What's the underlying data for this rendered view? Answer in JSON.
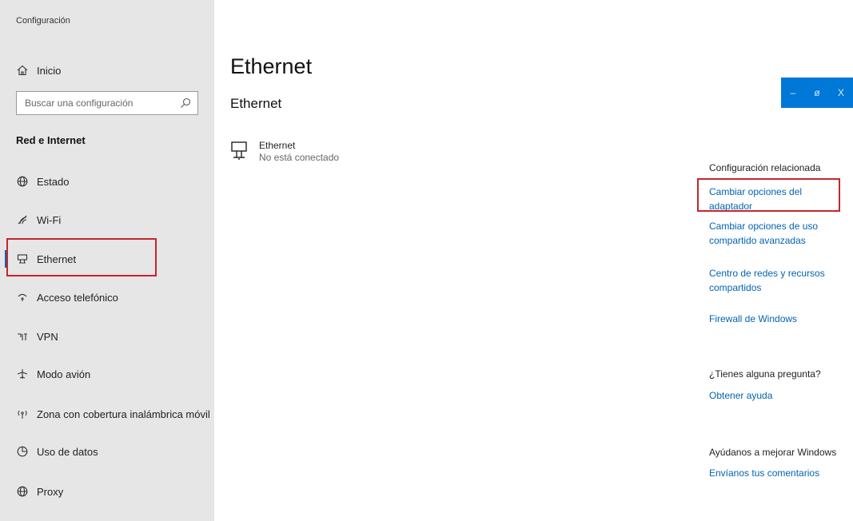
{
  "window": {
    "app_title": "Configuración"
  },
  "sidebar": {
    "home_label": "Inicio",
    "search_placeholder": "Buscar una configuración",
    "section_title": "Red e Internet",
    "items": [
      {
        "label": "Estado",
        "icon": "globe-status-icon"
      },
      {
        "label": "Wi-Fi",
        "icon": "wifi-icon"
      },
      {
        "label": "Ethernet",
        "icon": "ethernet-icon",
        "selected": true
      },
      {
        "label": "Acceso telefónico",
        "icon": "dialup-icon"
      },
      {
        "label": "VPN",
        "icon": "vpn-icon"
      },
      {
        "label": "Modo avión",
        "icon": "airplane-icon"
      },
      {
        "label": "Zona con cobertura inalámbrica móvil",
        "icon": "hotspot-icon"
      },
      {
        "label": "Uso de datos",
        "icon": "data-usage-icon"
      },
      {
        "label": "Proxy",
        "icon": "proxy-icon"
      }
    ]
  },
  "main": {
    "page_title": "Ethernet",
    "sub_title": "Ethernet",
    "network": {
      "name": "Ethernet",
      "status": "No está conectado"
    }
  },
  "window_controls": {
    "minimize": "–",
    "restore": "ø",
    "close": "X"
  },
  "related": {
    "heading": "Configuración relacionada",
    "links": [
      "Cambiar opciones del adaptador",
      "Cambiar opciones de uso compartido avanzadas",
      "Centro de redes y recursos compartidos",
      "Firewall de Windows"
    ]
  },
  "help": {
    "heading": "¿Tienes alguna pregunta?",
    "link": "Obtener ayuda"
  },
  "feedback": {
    "heading": "Ayúdanos a mejorar Windows",
    "link": "Envíanos tus comentarios"
  },
  "colors": {
    "sidebar_bg": "#e6e6e6",
    "accent": "#0078d7",
    "link": "#0063b1",
    "highlight": "#c4262e"
  }
}
